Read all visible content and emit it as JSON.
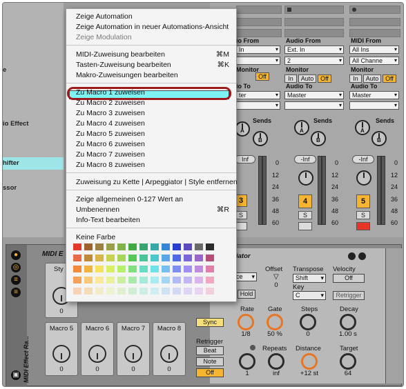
{
  "menu": {
    "items": [
      {
        "label": "Zeige Automation",
        "shortcut": "",
        "disabled": false
      },
      {
        "label": "Zeige Automation in neuer Automations-Ansicht",
        "shortcut": "",
        "disabled": false
      },
      {
        "label": "Zeige Modulation",
        "shortcut": "",
        "disabled": true
      },
      {
        "label": "MIDI-Zuweisung bearbeiten",
        "shortcut": "⌘M",
        "disabled": false
      },
      {
        "label": "Tasten-Zuweisung bearbeiten",
        "shortcut": "⌘K",
        "disabled": false
      },
      {
        "label": "Makro-Zuweisungen bearbeiten",
        "shortcut": "",
        "disabled": false
      },
      {
        "label": "Zu Macro 1 zuweisen",
        "shortcut": "",
        "disabled": false,
        "highlighted": true
      },
      {
        "label": "Zu Macro 2 zuweisen",
        "shortcut": "",
        "disabled": false
      },
      {
        "label": "Zu Macro 3 zuweisen",
        "shortcut": "",
        "disabled": false
      },
      {
        "label": "Zu Macro 4 zuweisen",
        "shortcut": "",
        "disabled": false
      },
      {
        "label": "Zu Macro 5 zuweisen",
        "shortcut": "",
        "disabled": false
      },
      {
        "label": "Zu Macro 6 zuweisen",
        "shortcut": "",
        "disabled": false
      },
      {
        "label": "Zu Macro 7 zuweisen",
        "shortcut": "",
        "disabled": false
      },
      {
        "label": "Zu Macro 8 zuweisen",
        "shortcut": "",
        "disabled": false
      },
      {
        "label": "Zuweisung zu Kette | Arpeggiator | Style entfernen",
        "shortcut": "",
        "disabled": false
      },
      {
        "label": "Zeige allgemeinen 0-127 Wert an",
        "shortcut": "",
        "disabled": false
      },
      {
        "label": "Umbenennen",
        "shortcut": "⌘R",
        "disabled": false
      },
      {
        "label": "Info-Text bearbeiten",
        "shortcut": "",
        "disabled": false
      },
      {
        "label": "Keine Farbe",
        "shortcut": "",
        "disabled": false
      }
    ],
    "color_swatches": [
      [
        "#e23a2a",
        "#a0622c",
        "#9d7e45",
        "#9aa04a",
        "#80b24a",
        "#41a843",
        "#39a46e",
        "#37a7a8",
        "#3585d6",
        "#2a3fcf",
        "#5b4bbd",
        "#6a6a6a",
        "#2b2b2b"
      ],
      [
        "#ea6b48",
        "#bf8a3a",
        "#d8b54a",
        "#c7d24e",
        "#a7d65a",
        "#58c756",
        "#4bc49a",
        "#4cc8cc",
        "#5aa6e6",
        "#4f6be3",
        "#7b67d8",
        "#9a66c8",
        "#b54f79"
      ],
      [
        "#f28a3a",
        "#f0b43e",
        "#f6e25a",
        "#d9ef62",
        "#b6f06a",
        "#7fe07c",
        "#67dcc1",
        "#6fe2e9",
        "#76bff0",
        "#7d8ff0",
        "#a08ef0",
        "#c08ce0",
        "#e07eaa"
      ],
      [
        "#f6a15a",
        "#f8c978",
        "#fbe99b",
        "#e9f29a",
        "#cdeea0",
        "#a9e9aa",
        "#a5ead6",
        "#a8ecf0",
        "#a6d6f5",
        "#b0bbf5",
        "#c3b6f5",
        "#d9b5ee",
        "#f2a8c3"
      ],
      [
        "#f7d2b6",
        "#f3dcb6",
        "#f3ecc8",
        "#eef3cf",
        "#e0f0cf",
        "#cfeed2",
        "#cdeee4",
        "#cfeef2",
        "#cfe2f4",
        "#d3d8f4",
        "#ddd6f4",
        "#e8d4f0",
        "#f4d0df"
      ]
    ]
  },
  "browser": {
    "items": [
      "e",
      "io Effect",
      "hifter",
      "ssor"
    ]
  },
  "mixer": {
    "strips": [
      {
        "audio_from_label": "Audio From",
        "input": "Ext. In",
        "channel": "2",
        "monitor_label": "Monitor",
        "monitor": [
          "In",
          "Auto",
          "Off"
        ],
        "audio_to_label": "Audio To",
        "output": "Master",
        "sends_label": "Sends",
        "send_a": "A",
        "send_b": "B",
        "volume": "-Inf",
        "track_number": "4",
        "solo": "S"
      },
      {
        "audio_from_label": "MIDI From",
        "input": "All Ins",
        "channel": "All Channe",
        "monitor_label": "Monitor",
        "monitor": [
          "In",
          "Auto",
          "Off"
        ],
        "audio_to_label": "Audio To",
        "output": "Master",
        "sends_label": "Sends",
        "send_a": "A",
        "send_b": "B",
        "volume": "-Inf",
        "track_number": "5",
        "solo": "S"
      }
    ],
    "partial_strip": {
      "audio_from_label": "io From",
      "input": "In",
      "monitor_label": "Monitor",
      "off": "Off",
      "audio_to_label": "io To",
      "output": "ter",
      "sends_label": "Sends",
      "send_a": "A",
      "send_b": "B",
      "volume": "Inf",
      "track_number": "3",
      "solo": "S"
    },
    "meter_scale": [
      "0",
      "12",
      "24",
      "36",
      "48",
      "60"
    ]
  },
  "device": {
    "title": "MIDI Effect Ra...",
    "rack_header": "MIDI E",
    "style_label": "Sty",
    "macros": [
      {
        "name": "Macro 5",
        "value": "0"
      },
      {
        "name": "Macro 6",
        "value": "0"
      },
      {
        "name": "Macro 7",
        "value": "0"
      },
      {
        "name": "Macro 8",
        "value": "0"
      }
    ],
    "macro_top_value": "0",
    "arp": {
      "header": "iator",
      "style_value": "ce",
      "hold": "Hold",
      "offset_label": "Offset",
      "offset_value": "0",
      "transpose_label": "Transpose",
      "transpose_value": "Shift",
      "key_label": "Key",
      "key_value": "C",
      "velocity_label": "Velocity",
      "velocity_value": "Off",
      "retrigger_btn": "Retrigger",
      "sync": "Sync",
      "rate_label": "Rate",
      "rate_value": "1/8",
      "gate_label": "Gate",
      "gate_value": "50 %",
      "steps_label": "Steps",
      "steps_value": "0",
      "decay_label": "Decay",
      "decay_value": "1.00 s",
      "retrigger_label": "Retrigger",
      "beat": "Beat",
      "note": "Note",
      "off": "Off",
      "repeats_label": "Repeats",
      "repeats_value": "inf",
      "knob1_value": "1",
      "distance_label": "Distance",
      "distance_value": "+12 st",
      "target_label": "Target",
      "target_value": "64"
    }
  }
}
